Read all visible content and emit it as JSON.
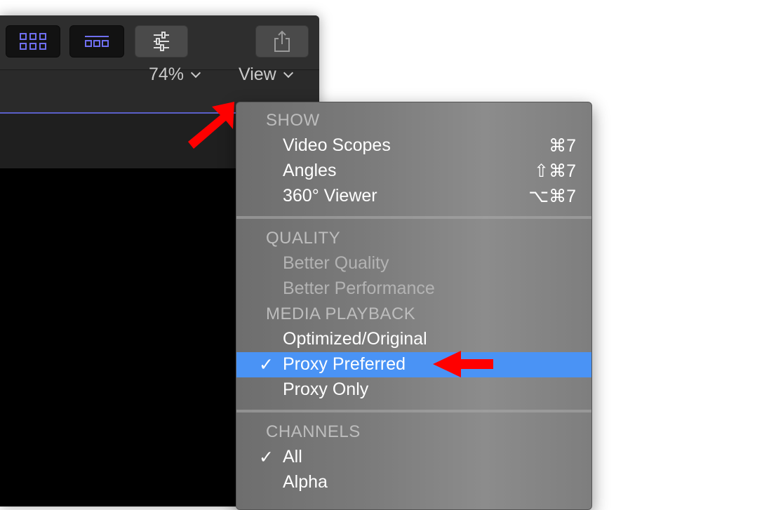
{
  "toolbar": {
    "buttons": [
      {
        "icon": "browser-grid-icon"
      },
      {
        "icon": "timeline-filmstrip-icon"
      },
      {
        "icon": "inspector-sliders-icon"
      },
      {
        "icon": "share-icon"
      }
    ]
  },
  "viewer": {
    "zoom": "74%",
    "view_label": "View"
  },
  "menu": {
    "show_header": "SHOW",
    "show_items": [
      {
        "label": "Video Scopes",
        "shortcut": "⌘7"
      },
      {
        "label": "Angles",
        "shortcut": "⇧⌘7"
      },
      {
        "label": "360° Viewer",
        "shortcut": "⌥⌘7"
      }
    ],
    "quality_header": "QUALITY",
    "quality_items": [
      {
        "label": "Better Quality"
      },
      {
        "label": "Better Performance"
      }
    ],
    "playback_header": "MEDIA PLAYBACK",
    "playback_items": [
      {
        "label": "Optimized/Original"
      },
      {
        "label": "Proxy Preferred",
        "check": "✓"
      },
      {
        "label": "Proxy Only"
      }
    ],
    "channels_header": "CHANNELS",
    "channels_items": [
      {
        "label": "All",
        "check": "✓"
      },
      {
        "label": "Alpha"
      }
    ]
  },
  "colors": {
    "accent": "#5a5fc8",
    "selection": "#4a93f5",
    "annotation": "#ff0000"
  }
}
